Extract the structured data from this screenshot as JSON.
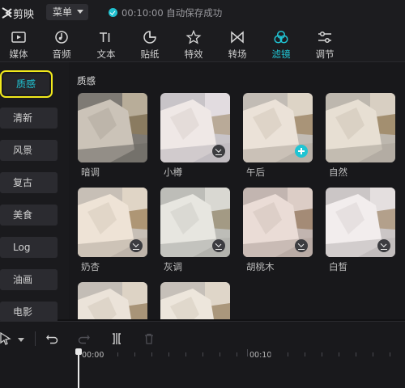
{
  "app": {
    "name": "剪映"
  },
  "titlebar": {
    "menu_label": "菜单",
    "save_status": "00:10:00 自动保存成功"
  },
  "toolbar": {
    "items": [
      {
        "label": "媒体",
        "icon": "media-icon"
      },
      {
        "label": "音频",
        "icon": "audio-icon"
      },
      {
        "label": "文本",
        "icon": "text-icon"
      },
      {
        "label": "贴纸",
        "icon": "sticker-icon"
      },
      {
        "label": "特效",
        "icon": "effects-icon"
      },
      {
        "label": "转场",
        "icon": "transition-icon"
      },
      {
        "label": "滤镜",
        "icon": "filter-icon",
        "active": true
      },
      {
        "label": "调节",
        "icon": "adjust-icon"
      }
    ]
  },
  "sidebar": {
    "categories": [
      {
        "label": "质感",
        "active": true
      },
      {
        "label": "清新"
      },
      {
        "label": "风景"
      },
      {
        "label": "复古"
      },
      {
        "label": "美食"
      },
      {
        "label": "Log"
      },
      {
        "label": "油画"
      },
      {
        "label": "电影"
      }
    ]
  },
  "panel": {
    "section_title": "质感",
    "filters": [
      {
        "label": "暗调",
        "badge": "none"
      },
      {
        "label": "小樽",
        "badge": "download"
      },
      {
        "label": "午后",
        "badge": "add"
      },
      {
        "label": "自然",
        "badge": "none"
      },
      {
        "label": "奶杏",
        "badge": "download"
      },
      {
        "label": "灰调",
        "badge": "download"
      },
      {
        "label": "胡桃木",
        "badge": "download"
      },
      {
        "label": "白皙",
        "badge": "download"
      },
      {
        "label": "",
        "badge": "none"
      },
      {
        "label": "",
        "badge": "none"
      }
    ]
  },
  "timeline": {
    "ruler_labels": [
      "00:00",
      "00:10"
    ]
  },
  "colors": {
    "accent": "#20c4d3",
    "highlight": "#f2ea1c",
    "background": "#121214"
  }
}
